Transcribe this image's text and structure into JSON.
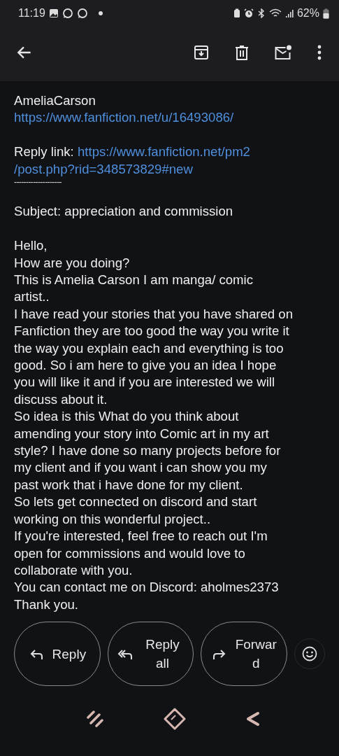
{
  "status_bar": {
    "time": "11:19",
    "battery": "62%"
  },
  "message": {
    "sender": "AmeliaCarson",
    "sender_link": "https://www.fanfiction.net/u/16493086/",
    "reply_label": "Reply link:",
    "reply_link_lines": [
      "https://www.fanfiction.net/pm2",
      "/post.php?rid=348573829#new"
    ],
    "separator": "--------------------",
    "subject": "Subject: appreciation and commission",
    "body_lines": [
      "Hello,",
      "How are you doing?",
      "This is Amelia Carson I am manga/ comic",
      "artist..",
      "I have read your stories that you have shared on",
      "Fanfiction they are too good the way you write it",
      "the way you explain each and everything is too",
      "good. So i am here to give you an idea I hope",
      "you will like it and if you are interested we will",
      "discuss about it.",
      "So idea is this What do you think about",
      "amending your story into Comic art in my art",
      "style? I have done so many projects before for",
      "my client and if you want i can show you my",
      "past work that i have done for my client.",
      "So lets get connected on discord and start",
      "working on this wonderful project..",
      "If you're interested, feel free to reach out I'm",
      "open for commissions and would love to",
      "collaborate with you.",
      "You can contact me on Discord: aholmes2373",
      "Thank you."
    ]
  },
  "actions": [
    {
      "kind": "reply",
      "label": "Reply"
    },
    {
      "kind": "reply_all",
      "label": "Reply all"
    },
    {
      "kind": "forward",
      "label": "Forward"
    }
  ]
}
